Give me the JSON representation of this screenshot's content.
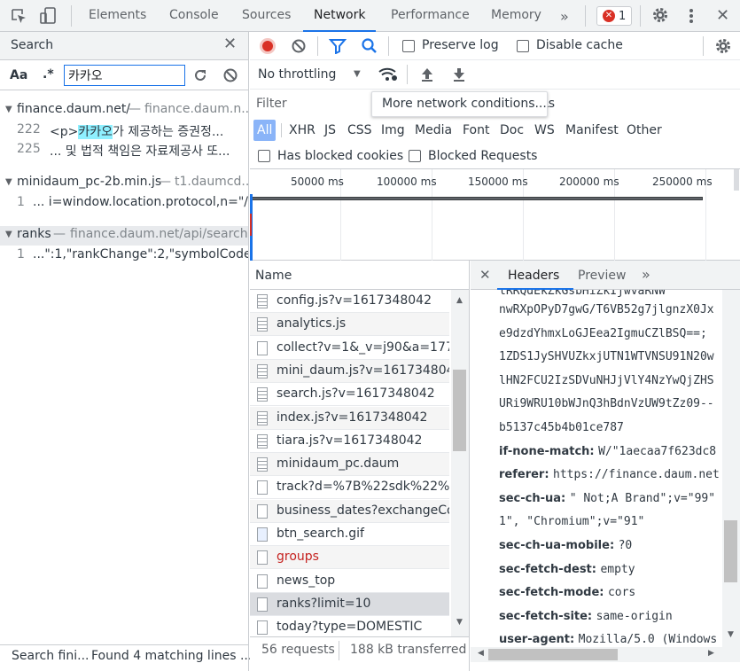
{
  "tabs": {
    "elements": "Elements",
    "console": "Console",
    "sources": "Sources",
    "network": "Network",
    "performance": "Performance",
    "memory": "Memory",
    "error_count": "1"
  },
  "search": {
    "title": "Search",
    "case_label": "Aa",
    "regex_label": ".*",
    "query": "카카오",
    "results": [
      {
        "file": "finance.daum.net/",
        "url": "finance.daum.n...",
        "lines": [
          {
            "num": "222",
            "pre": "<p>",
            "match": "카카오",
            "post": "가 제공하는 증권정..."
          },
          {
            "num": "225",
            "pre": "... 및 법적 책임은 자료제공사 또...",
            "match": "",
            "post": ""
          }
        ]
      },
      {
        "file": "minidaum_pc-2b.min.js",
        "url": "t1.daumcd...",
        "lines": [
          {
            "num": "1",
            "pre": "... i=window.location.protocol,n=\"/...",
            "match": "",
            "post": ""
          }
        ]
      },
      {
        "file": "ranks",
        "url": "finance.daum.net/api/search...",
        "lines": [
          {
            "num": "1",
            "pre": "...\":1,\"rankChange\":2,\"symbolCode...",
            "match": "",
            "post": ""
          }
        ]
      }
    ],
    "status": "Search fini...",
    "status_found": "Found 4 matching lines ..."
  },
  "network": {
    "preserve_log": "Preserve log",
    "disable_cache": "Disable cache",
    "throttling": "No throttling",
    "filter_placeholder": "Filter",
    "tooltip": "More network conditions...",
    "tooltip_suffix": "Ls",
    "types": [
      "All",
      "XHR",
      "JS",
      "CSS",
      "Img",
      "Media",
      "Font",
      "Doc",
      "WS",
      "Manifest",
      "Other"
    ],
    "has_blocked_cookies": "Has blocked cookies",
    "blocked_requests": "Blocked Requests",
    "timeline_ticks": [
      "50000 ms",
      "100000 ms",
      "150000 ms",
      "200000 ms",
      "250000 ms"
    ],
    "name_header": "Name",
    "requests": [
      {
        "name": "config.js?v=1617348042",
        "kind": "js",
        "color": "#303942"
      },
      {
        "name": "analytics.js",
        "kind": "js",
        "color": "#303942"
      },
      {
        "name": "collect?v=1&_v=j90&a=17795",
        "kind": "doc",
        "color": "#303942"
      },
      {
        "name": "mini_daum.js?v=1617348042",
        "kind": "js",
        "color": "#303942"
      },
      {
        "name": "search.js?v=1617348042",
        "kind": "js",
        "color": "#303942"
      },
      {
        "name": "index.js?v=1617348042",
        "kind": "js",
        "color": "#303942"
      },
      {
        "name": "tiara.js?v=1617348042",
        "kind": "js",
        "color": "#303942"
      },
      {
        "name": "minidaum_pc.daum",
        "kind": "js",
        "color": "#303942"
      },
      {
        "name": "track?d=%7B%22sdk%22%3A",
        "kind": "doc",
        "color": "#303942"
      },
      {
        "name": "business_dates?exchangeCou",
        "kind": "doc",
        "color": "#303942"
      },
      {
        "name": "btn_search.gif",
        "kind": "img",
        "color": "#303942"
      },
      {
        "name": "groups",
        "kind": "doc",
        "color": "#c5221f"
      },
      {
        "name": "news_top",
        "kind": "doc",
        "color": "#303942"
      },
      {
        "name": "ranks?limit=10",
        "kind": "doc",
        "color": "#303942",
        "selected": true
      },
      {
        "name": "today?type=DOMESTIC",
        "kind": "doc",
        "color": "#303942"
      }
    ],
    "summary_requests": "56 requests",
    "summary_transferred": "188 kB transferred"
  },
  "headers_panel": {
    "tab_headers": "Headers",
    "tab_preview": "Preview",
    "lines": [
      {
        "key": "",
        "val": "nwRXpOPyD7gwG/T6VB52g7jlgnzX0Jx"
      },
      {
        "key": "",
        "val": "e9dzdYhmxLoGJEea2IgmuCZlBSQ==;"
      },
      {
        "key": "",
        "val": "1ZDS1JySHVUZkxjUTN1WTVNSU91N20w"
      },
      {
        "key": "",
        "val": "lHN2FCU2IzSDVuNHJjVlY4NzYwQjZHS"
      },
      {
        "key": "",
        "val": "URi9WRU10bWJnQ3hBdnVzUW9tZz09--"
      },
      {
        "key": "",
        "val": "b5137c45b4b01ce787"
      },
      {
        "key": "if-none-match:",
        "val": "W/\"1aecaa7f623dc8"
      },
      {
        "key": "referer:",
        "val": "https://finance.daum.net"
      },
      {
        "key": "sec-ch-ua:",
        "val": "\" Not;A Brand\";v=\"99\""
      },
      {
        "key": "",
        "val": "1\", \"Chromium\";v=\"91\""
      },
      {
        "key": "sec-ch-ua-mobile:",
        "val": "?0"
      },
      {
        "key": "sec-fetch-dest:",
        "val": "empty"
      },
      {
        "key": "sec-fetch-mode:",
        "val": "cors"
      },
      {
        "key": "sec-fetch-site:",
        "val": "same-origin"
      },
      {
        "key": "user-agent:",
        "val": "Mozilla/5.0 (Windows"
      }
    ]
  },
  "colors": {
    "accent": "#1a73e8",
    "record": "#d93025",
    "match_bg": "#8ff0ff"
  }
}
